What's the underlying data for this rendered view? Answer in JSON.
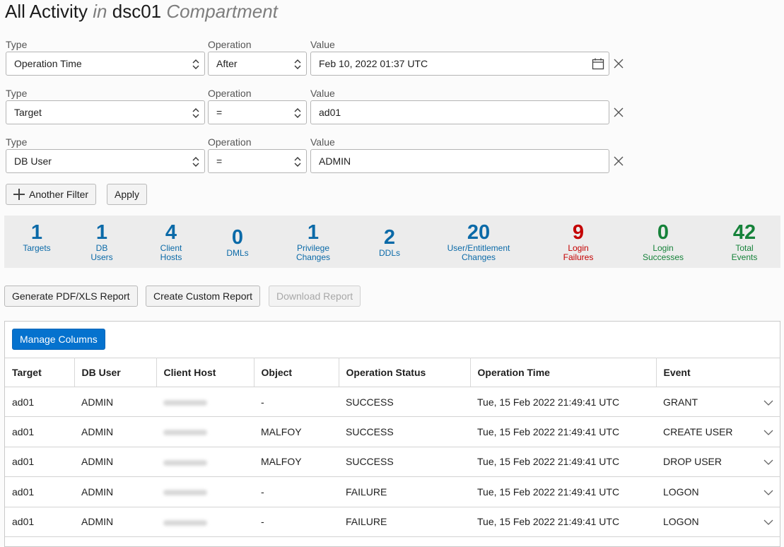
{
  "title": {
    "main": "All Activity",
    "in": "in",
    "compartment_name": "dsc01",
    "compartment": "Compartment"
  },
  "filters": [
    {
      "type_label": "Type",
      "type": "Operation Time",
      "op_label": "Operation",
      "op": "After",
      "value_label": "Value",
      "value": "Feb 10, 2022 01:37 UTC"
    },
    {
      "type_label": "Type",
      "type": "Target",
      "op_label": "Operation",
      "op": "=",
      "value_label": "Value",
      "value": "ad01"
    },
    {
      "type_label": "Type",
      "type": "DB User",
      "op_label": "Operation",
      "op": "=",
      "value_label": "Value",
      "value": "ADMIN"
    }
  ],
  "actions": {
    "another_filter": "Another Filter",
    "apply": "Apply"
  },
  "stats": [
    {
      "value": "1",
      "label1": "Targets",
      "label2": ""
    },
    {
      "value": "1",
      "label1": "DB",
      "label2": "Users"
    },
    {
      "value": "4",
      "label1": "Client",
      "label2": "Hosts"
    },
    {
      "value": "0",
      "label1": "DMLs",
      "label2": ""
    },
    {
      "value": "1",
      "label1": "Privilege",
      "label2": "Changes"
    },
    {
      "value": "2",
      "label1": "DDLs",
      "label2": ""
    },
    {
      "value": "20",
      "label1": "User/Entitlement",
      "label2": "Changes"
    },
    {
      "value": "9",
      "label1": "Login",
      "label2": "Failures"
    },
    {
      "value": "0",
      "label1": "Login",
      "label2": "Successes"
    },
    {
      "value": "42",
      "label1": "Total",
      "label2": "Events"
    }
  ],
  "stat_colors": {
    "blue": "#0b6aa8",
    "red": "#c40000",
    "green": "#16823a"
  },
  "reports": {
    "generate": "Generate PDF/XLS Report",
    "custom": "Create Custom Report",
    "download": "Download Report"
  },
  "table": {
    "manage_columns": "Manage Columns",
    "headers": [
      "Target",
      "DB User",
      "Client Host",
      "Object",
      "Operation Status",
      "Operation Time",
      "Event"
    ],
    "rows": [
      {
        "target": "ad01",
        "db_user": "ADMIN",
        "object": "-",
        "status": "SUCCESS",
        "time": "Tue, 15 Feb 2022 21:49:41 UTC",
        "event": "GRANT"
      },
      {
        "target": "ad01",
        "db_user": "ADMIN",
        "object": "MALFOY",
        "status": "SUCCESS",
        "time": "Tue, 15 Feb 2022 21:49:41 UTC",
        "event": "CREATE USER"
      },
      {
        "target": "ad01",
        "db_user": "ADMIN",
        "object": "MALFOY",
        "status": "SUCCESS",
        "time": "Tue, 15 Feb 2022 21:49:41 UTC",
        "event": "DROP USER"
      },
      {
        "target": "ad01",
        "db_user": "ADMIN",
        "object": "-",
        "status": "FAILURE",
        "time": "Tue, 15 Feb 2022 21:49:41 UTC",
        "event": "LOGON"
      },
      {
        "target": "ad01",
        "db_user": "ADMIN",
        "object": "-",
        "status": "FAILURE",
        "time": "Tue, 15 Feb 2022 21:49:41 UTC",
        "event": "LOGON"
      }
    ]
  }
}
